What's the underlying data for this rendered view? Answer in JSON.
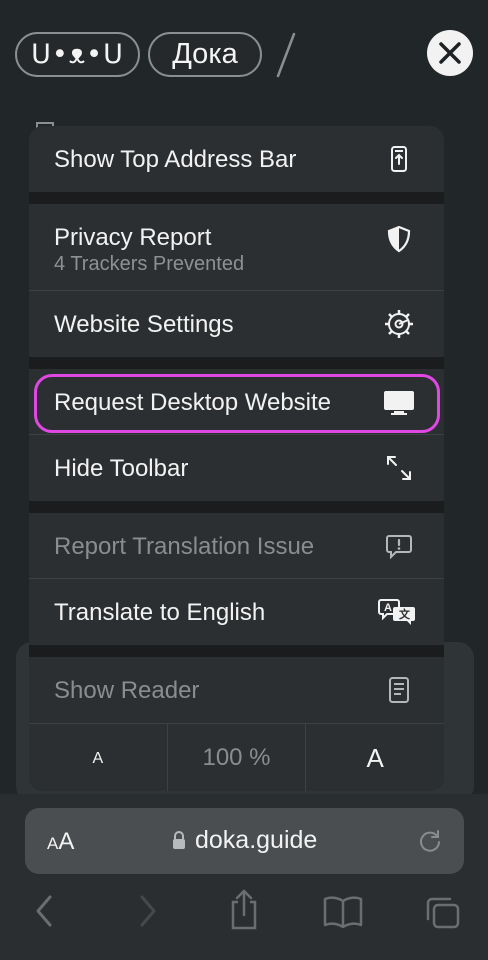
{
  "header": {
    "logo_text": "U•ᴥ•U",
    "site_pill": "Дока"
  },
  "menu": {
    "show_top_address_bar": "Show Top Address Bar",
    "privacy_report": "Privacy Report",
    "privacy_subtitle": "4 Trackers Prevented",
    "website_settings": "Website Settings",
    "request_desktop": "Request Desktop Website",
    "hide_toolbar": "Hide Toolbar",
    "report_translation": "Report Translation Issue",
    "translate": "Translate to English",
    "show_reader": "Show Reader",
    "font_small": "A",
    "zoom_level": "100 %",
    "font_large": "A"
  },
  "address_bar": {
    "aa_small": "A",
    "aa_large": "A",
    "url": "doka.guide"
  },
  "colors": {
    "highlight": "#e048e4",
    "menu_bg": "#2c2f31"
  },
  "icons": [
    "close-icon",
    "top-address-bar-icon",
    "shield-icon",
    "gear-icon",
    "desktop-icon",
    "expand-icon",
    "report-bubble-icon",
    "translate-icon",
    "reader-icon",
    "lock-icon",
    "reload-icon",
    "back-icon",
    "forward-icon",
    "share-icon",
    "bookmarks-icon",
    "tabs-icon"
  ]
}
